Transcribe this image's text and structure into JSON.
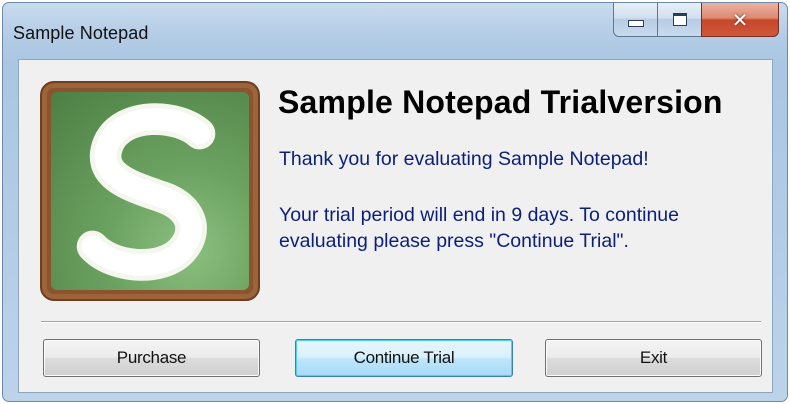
{
  "window": {
    "title": "Sample Notepad"
  },
  "icons": {
    "minimize": "minimize-icon",
    "maximize": "maximize-icon",
    "close": "close-icon",
    "logo": "app-logo-s"
  },
  "dialog": {
    "heading": "Sample Notepad Trialversion",
    "thanks_message": "Thank you for evaluating Sample Notepad!",
    "trial_message": "Your trial period will end in 9 days. To continue evaluating please press \"Continue Trial\"."
  },
  "buttons": {
    "purchase_label": "Purchase",
    "continue_label": "Continue Trial",
    "exit_label": "Exit"
  },
  "colors": {
    "message_text": "#0b1f7a",
    "logo_frame": "#8a5430",
    "logo_green": "#6ba160",
    "close_button": "#c6472a",
    "default_button_border": "#3c7fb1"
  }
}
